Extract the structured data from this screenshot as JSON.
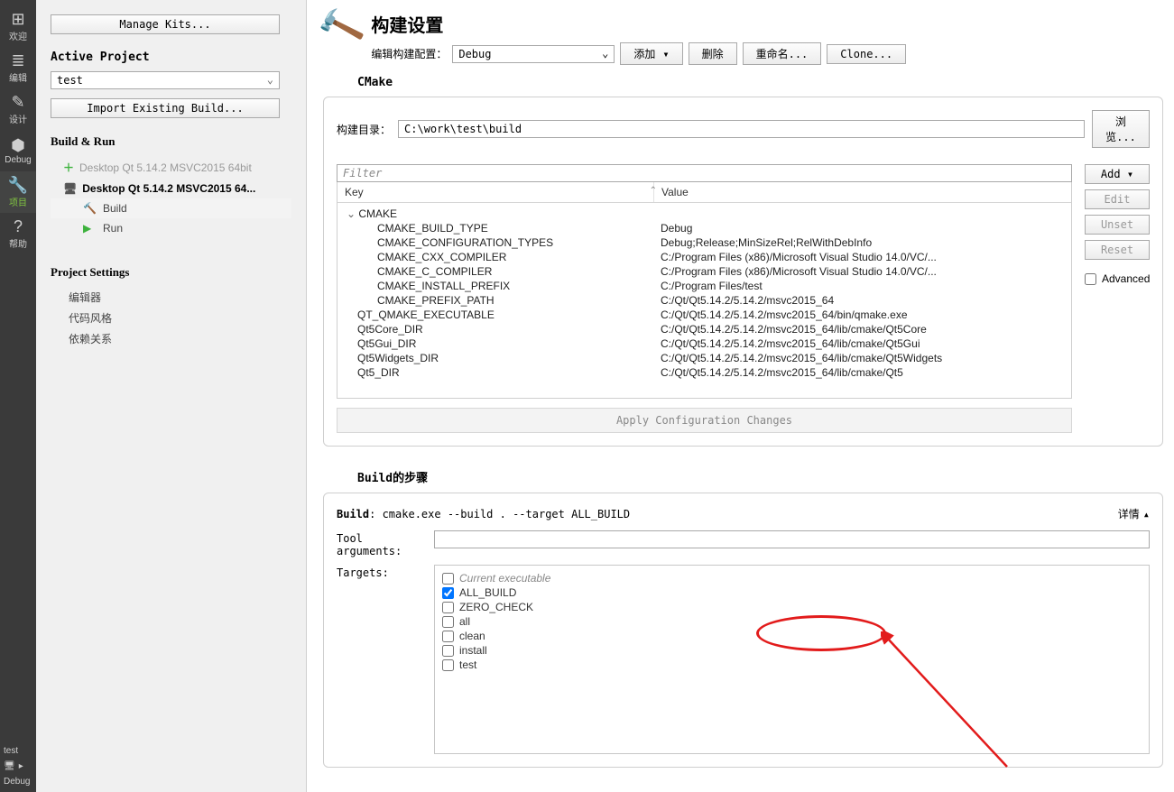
{
  "icon_strip": [
    {
      "label": "欢迎",
      "glyph": "⊞"
    },
    {
      "label": "编辑",
      "glyph": "≣"
    },
    {
      "label": "设计",
      "glyph": "✎"
    },
    {
      "label": "Debug",
      "glyph": "⬢"
    },
    {
      "label": "项目",
      "glyph": "🔧",
      "active": true
    },
    {
      "label": "帮助",
      "glyph": "?"
    }
  ],
  "bottom": {
    "project": "test",
    "config": "Debug",
    "run_glyph": "▶"
  },
  "side": {
    "manage_kits": "Manage Kits...",
    "active_project_title": "Active Project",
    "project_name": "test",
    "import_btn": "Import Existing Build...",
    "build_run_title": "Build & Run",
    "kit_inactive": "Desktop Qt 5.14.2 MSVC2015 64bit",
    "kit_active": "Desktop Qt 5.14.2 MSVC2015 64...",
    "tree_build": "Build",
    "tree_run": "Run",
    "settings_title": "Project Settings",
    "settings_items": [
      "编辑器",
      "代码风格",
      "依赖关系"
    ]
  },
  "header": {
    "title": "构建设置",
    "config_label": "编辑构建配置：",
    "config_value": "Debug",
    "add": "添加",
    "del": "删除",
    "rename": "重命名...",
    "clone": "Clone..."
  },
  "cmake": {
    "section": "CMake",
    "build_dir_label": "构建目录：",
    "build_dir": "C:\\work\\test\\build",
    "browse": "浏览...",
    "filter_placeholder": "Filter",
    "col_key": "Key",
    "col_val": "Value",
    "group": "CMAKE",
    "rows": [
      {
        "k": "CMAKE_BUILD_TYPE",
        "v": "Debug",
        "lvl": 2
      },
      {
        "k": "CMAKE_CONFIGURATION_TYPES",
        "v": "Debug;Release;MinSizeRel;RelWithDebInfo",
        "lvl": 2
      },
      {
        "k": "CMAKE_CXX_COMPILER",
        "v": "C:/Program Files (x86)/Microsoft Visual Studio 14.0/VC/...",
        "lvl": 2
      },
      {
        "k": "CMAKE_C_COMPILER",
        "v": "C:/Program Files (x86)/Microsoft Visual Studio 14.0/VC/...",
        "lvl": 2
      },
      {
        "k": "CMAKE_INSTALL_PREFIX",
        "v": "C:/Program Files/test",
        "lvl": 2
      },
      {
        "k": "CMAKE_PREFIX_PATH",
        "v": "C:/Qt/Qt5.14.2/5.14.2/msvc2015_64",
        "lvl": 2
      },
      {
        "k": "QT_QMAKE_EXECUTABLE",
        "v": "C:/Qt/Qt5.14.2/5.14.2/msvc2015_64/bin/qmake.exe",
        "lvl": 1
      },
      {
        "k": "Qt5Core_DIR",
        "v": "C:/Qt/Qt5.14.2/5.14.2/msvc2015_64/lib/cmake/Qt5Core",
        "lvl": 1
      },
      {
        "k": "Qt5Gui_DIR",
        "v": "C:/Qt/Qt5.14.2/5.14.2/msvc2015_64/lib/cmake/Qt5Gui",
        "lvl": 1
      },
      {
        "k": "Qt5Widgets_DIR",
        "v": "C:/Qt/Qt5.14.2/5.14.2/msvc2015_64/lib/cmake/Qt5Widgets",
        "lvl": 1
      },
      {
        "k": "Qt5_DIR",
        "v": "C:/Qt/Qt5.14.2/5.14.2/msvc2015_64/lib/cmake/Qt5",
        "lvl": 1
      }
    ],
    "add": "Add",
    "edit": "Edit",
    "unset": "Unset",
    "reset": "Reset",
    "advanced": "Advanced",
    "apply": "Apply Configuration Changes"
  },
  "steps": {
    "title": "Build的步骤",
    "build_label": "Build",
    "build_cmd": "cmake.exe --build . --target ALL_BUILD",
    "details": "详情",
    "tool_args_label": "Tool arguments:",
    "tool_args": "",
    "targets_label": "Targets:",
    "targets": [
      {
        "name": "Current executable",
        "checked": false,
        "italic": true
      },
      {
        "name": "ALL_BUILD",
        "checked": true
      },
      {
        "name": "ZERO_CHECK",
        "checked": false
      },
      {
        "name": "all",
        "checked": false
      },
      {
        "name": "clean",
        "checked": false
      },
      {
        "name": "install",
        "checked": false
      },
      {
        "name": "test",
        "checked": false
      }
    ]
  }
}
